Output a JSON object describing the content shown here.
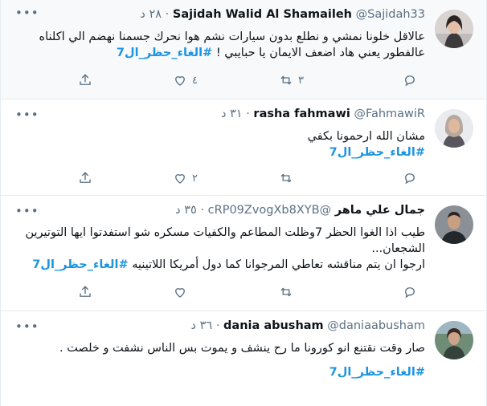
{
  "tweets": [
    {
      "name": "Sajidah Walid Al Shamaileh",
      "handle": "@Sajidah33",
      "time": "٢٨ د",
      "text_lines": [
        "عالاقل خلونا نمشي و نطلع بدون سيارات نشم هوا نحرك جسمنا نهضم الي اكلناه",
        "عالفطور يعني هاد  اضعف الايمان يا حبايبي !"
      ],
      "hashtag": "#الغاء_حظر_ال7",
      "counts": {
        "reply": "",
        "retweet": "٣",
        "like": "٤"
      }
    },
    {
      "name": "rasha fahmawi",
      "handle": "@FahmawiR",
      "time": "٣١ د",
      "text_lines": [
        "مشان الله ارحمونا بكفي"
      ],
      "hashtag": "#الغاء_حظر_ال7",
      "counts": {
        "reply": "",
        "retweet": "",
        "like": "٢"
      }
    },
    {
      "name": "جمال علي ماهر",
      "handle": "@cRP09ZvogXb8XYB",
      "time": "٣٥ د",
      "text_lines": [
        "طيب اذا الغوا الحظر 7وظلت المطاعم والكفيات مسكره شو استفدتوا ايها التوتيرين",
        "الشجعان...",
        "ارجوا ان يتم مناقشه تعاطي المرجوانا كما دول أمريكا اللاتينيه"
      ],
      "hashtag": "#الغاء_حظر_ال7",
      "counts": {
        "reply": "",
        "retweet": "",
        "like": ""
      }
    },
    {
      "name": "dania abusham",
      "handle": "@daniaabusham",
      "time": "٣٦ د",
      "text_lines": [
        "صار وقت نقتنع انو كورونا ما رح ينشف و يموت بس الناس نشفت و خلصت ."
      ],
      "hashtag": "#الغاء_حظر_ال7",
      "counts": {
        "reply": "",
        "retweet": "",
        "like": ""
      }
    }
  ],
  "icons": {
    "more": "more-icon",
    "reply": "reply-icon",
    "retweet": "retweet-icon",
    "like": "like-icon",
    "share": "share-icon"
  },
  "colors": {
    "hashtag": "#1b95e0",
    "muted": "#5b7083",
    "highlight_bg": "#f7f9fa",
    "divider": "#e6ecf0"
  }
}
